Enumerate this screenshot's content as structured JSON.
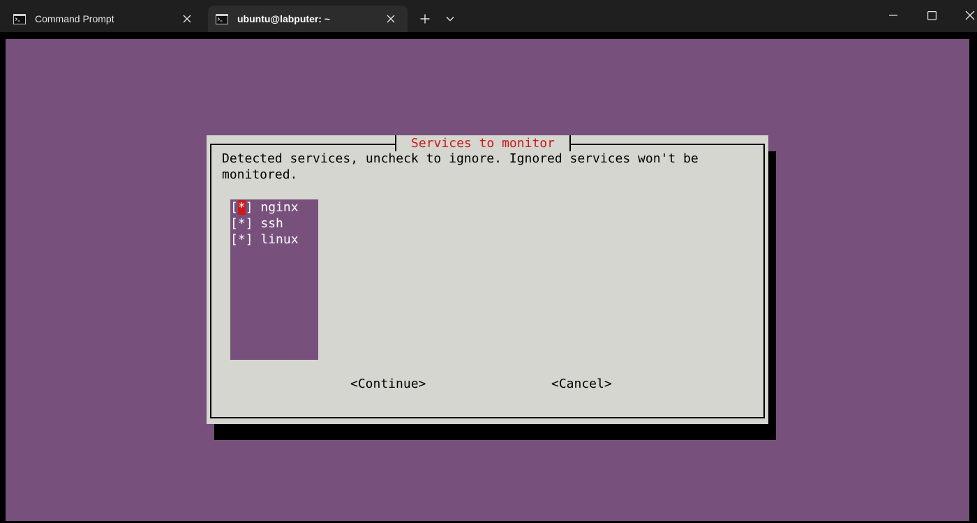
{
  "tabs": [
    {
      "label": "Command Prompt",
      "icon": "terminal-icon",
      "active": false
    },
    {
      "label": "ubuntu@labputer: ~",
      "icon": "terminal-icon",
      "active": true
    }
  ],
  "window_controls": [
    "minimize-icon",
    "maximize-icon",
    "close-icon"
  ],
  "dialog": {
    "title": "Services to monitor",
    "description_line1": "Detected services, uncheck to ignore. Ignored services won't be",
    "description_line2": "monitored.",
    "items": [
      {
        "bracket_open": "[",
        "mark": "*",
        "bracket_close": "]",
        "label": "nginx",
        "checked": true,
        "focused": true
      },
      {
        "bracket_open": "[",
        "mark": "*",
        "bracket_close": "]",
        "label": "ssh",
        "checked": true,
        "focused": false
      },
      {
        "bracket_open": "[",
        "mark": "*",
        "bracket_close": "]",
        "label": "linux",
        "checked": true,
        "focused": false
      }
    ],
    "continue_label": "<Continue>",
    "cancel_label": "<Cancel>"
  },
  "colors": {
    "terminal_bg": "#77517c",
    "dialog_bg": "#d4d6cf",
    "title_red": "#cc1a1a",
    "titlebar_bg": "#1f1f1f",
    "active_tab_bg": "#2c2c2c"
  }
}
